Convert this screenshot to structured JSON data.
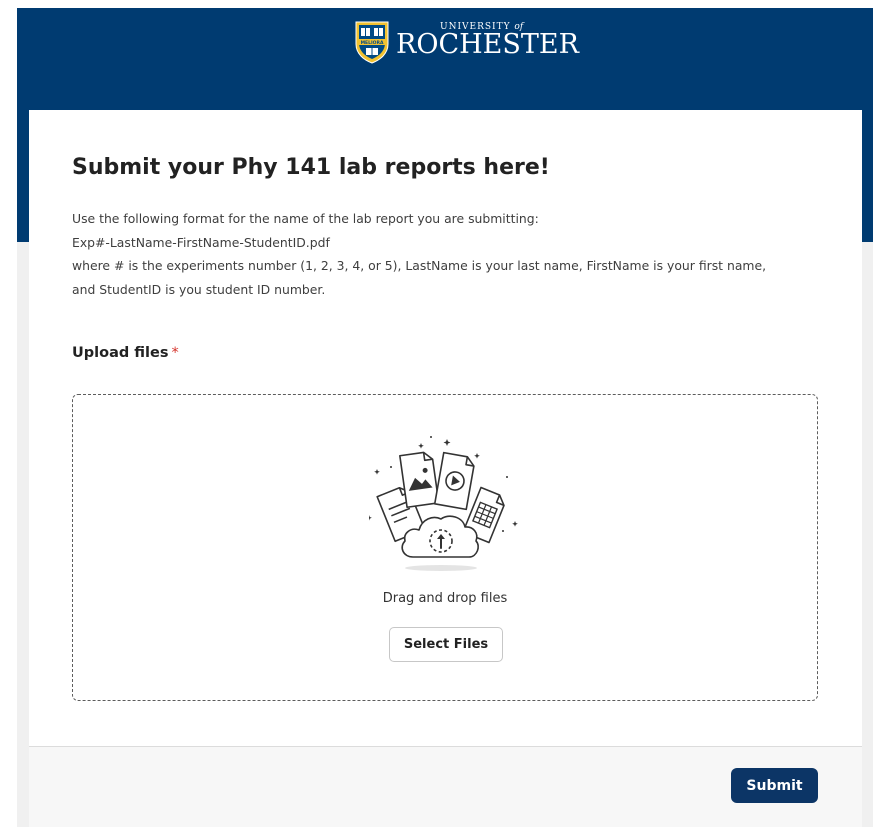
{
  "brand": {
    "university_top": "UNIVERSITY",
    "university_of": "of",
    "university_name": "ROCHESTER",
    "shield_motto": "MELIORA",
    "colors": {
      "navy": "#003b71",
      "gold": "#f2c230"
    }
  },
  "form": {
    "title": "Submit your Phy 141 lab reports here!",
    "description_lines": [
      "Use the following format for the name of the lab report you are submitting:",
      "Exp#-LastName-FirstName-StudentID.pdf",
      "where # is the experiments number (1, 2, 3, 4, or 5), LastName is your last name, FirstName is your first name,",
      "and StudentID is you student ID number."
    ]
  },
  "upload": {
    "label": "Upload files",
    "required_mark": "*",
    "drag_text": "Drag and drop files",
    "select_button": "Select Files",
    "illustration_icon": "cloud-upload-documents-icon"
  },
  "footer": {
    "submit_label": "Submit",
    "submit_color": "#0c3566"
  }
}
